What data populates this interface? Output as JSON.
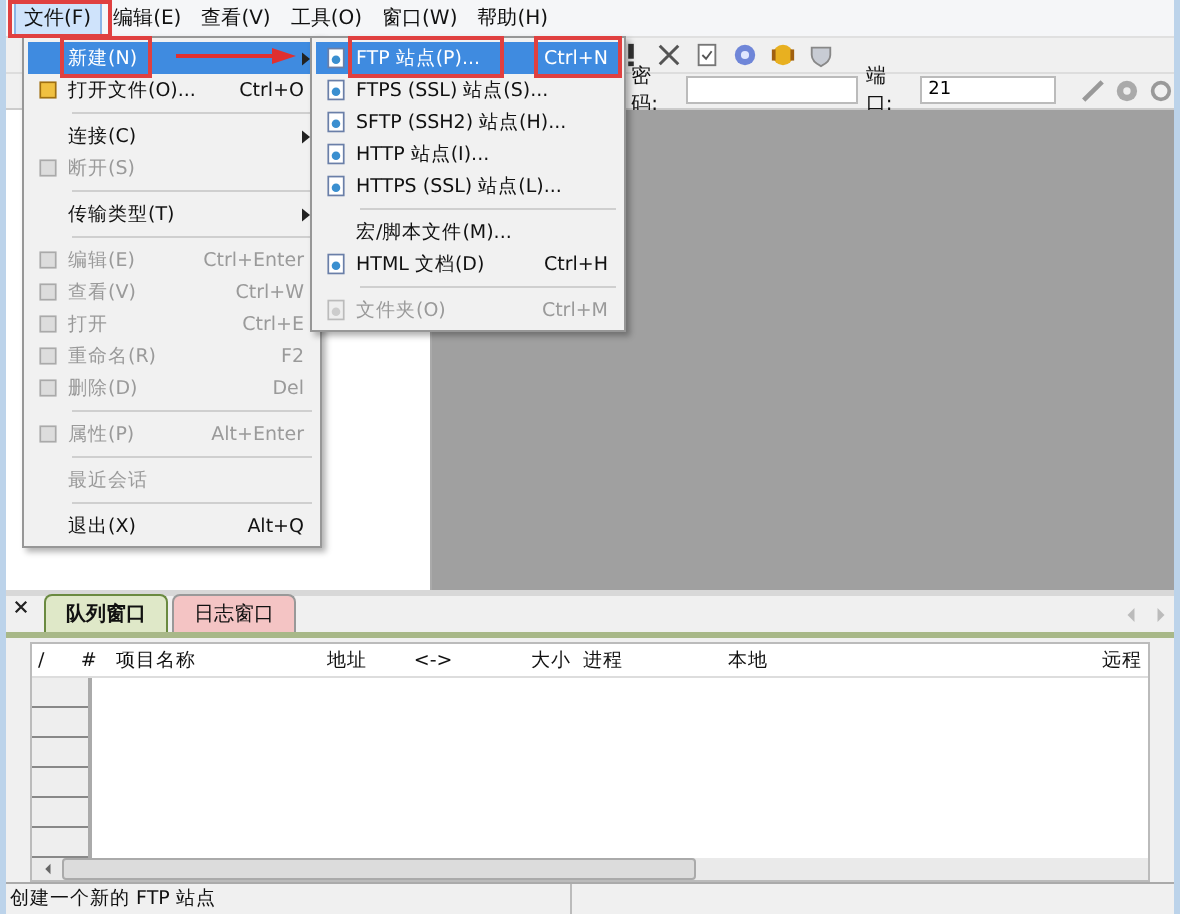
{
  "menubar": [
    {
      "label": "文件(F)",
      "selected": true
    },
    {
      "label": "编辑(E)",
      "selected": false
    },
    {
      "label": "查看(V)",
      "selected": false
    },
    {
      "label": "工具(O)",
      "selected": false
    },
    {
      "label": "窗口(W)",
      "selected": false
    },
    {
      "label": "帮助(H)",
      "selected": false
    }
  ],
  "toolbar": {
    "password_label": "密码:",
    "port_label": "端口:",
    "port_value": "21"
  },
  "file_menu": [
    {
      "kind": "item",
      "label": "新建(N)",
      "disabled": false,
      "selected": true,
      "submenu": true
    },
    {
      "kind": "item",
      "label": "打开文件(O)...",
      "shortcut": "Ctrl+O",
      "icon": true,
      "disabled": false,
      "selected": false
    },
    {
      "kind": "separator"
    },
    {
      "kind": "item",
      "label": "连接(C)",
      "disabled": false,
      "selected": false,
      "submenu": true
    },
    {
      "kind": "item",
      "label": "断开(S)",
      "icon": true,
      "disabled": true,
      "selected": false
    },
    {
      "kind": "separator"
    },
    {
      "kind": "item",
      "label": "传输类型(T)",
      "disabled": false,
      "selected": false,
      "submenu": true
    },
    {
      "kind": "separator"
    },
    {
      "kind": "item",
      "label": "编辑(E)",
      "shortcut": "Ctrl+Enter",
      "icon": true,
      "disabled": true,
      "selected": false
    },
    {
      "kind": "item",
      "label": "查看(V)",
      "shortcut": "Ctrl+W",
      "icon": true,
      "disabled": true,
      "selected": false
    },
    {
      "kind": "item",
      "label": "打开",
      "shortcut": "Ctrl+E",
      "icon": true,
      "disabled": true,
      "selected": false
    },
    {
      "kind": "item",
      "label": "重命名(R)",
      "shortcut": "F2",
      "icon": true,
      "disabled": true,
      "selected": false
    },
    {
      "kind": "item",
      "label": "删除(D)",
      "shortcut": "Del",
      "icon": true,
      "disabled": true,
      "selected": false
    },
    {
      "kind": "separator"
    },
    {
      "kind": "item",
      "label": "属性(P)",
      "shortcut": "Alt+Enter",
      "icon": true,
      "disabled": true,
      "selected": false
    },
    {
      "kind": "separator"
    },
    {
      "kind": "item",
      "label": "最近会话",
      "disabled": true,
      "selected": false
    },
    {
      "kind": "separator"
    },
    {
      "kind": "item",
      "label": "退出(X)",
      "shortcut": "Alt+Q",
      "disabled": false,
      "selected": false
    }
  ],
  "new_submenu": [
    {
      "kind": "item",
      "label": "FTP 站点(P)...",
      "shortcut": "Ctrl+N",
      "icon": true,
      "disabled": false,
      "selected": true
    },
    {
      "kind": "item",
      "label": "FTPS (SSL) 站点(S)...",
      "icon": true,
      "disabled": false,
      "selected": false
    },
    {
      "kind": "item",
      "label": "SFTP (SSH2) 站点(H)...",
      "icon": true,
      "disabled": false,
      "selected": false
    },
    {
      "kind": "item",
      "label": "HTTP 站点(I)...",
      "icon": true,
      "disabled": false,
      "selected": false
    },
    {
      "kind": "item",
      "label": "HTTPS (SSL) 站点(L)...",
      "icon": true,
      "disabled": false,
      "selected": false
    },
    {
      "kind": "separator"
    },
    {
      "kind": "item",
      "label": "宏/脚本文件(M)...",
      "disabled": false,
      "selected": false
    },
    {
      "kind": "item",
      "label": "HTML 文档(D)",
      "shortcut": "Ctrl+H",
      "icon": true,
      "disabled": false,
      "selected": false
    },
    {
      "kind": "separator"
    },
    {
      "kind": "item",
      "label": "文件夹(O)",
      "shortcut": "Ctrl+M",
      "icon": true,
      "disabled": true,
      "selected": false
    }
  ],
  "queue_tabs": [
    {
      "label": "队列窗口",
      "selected": true,
      "color": "#dfe8c8"
    },
    {
      "label": "日志窗口",
      "selected": false,
      "color": "#f4c4c4"
    }
  ],
  "table": {
    "columns": [
      "/",
      "#",
      "项目名称",
      "地址",
      "<->",
      "大小",
      "进程",
      "本地",
      "远程"
    ]
  },
  "status_bar": "创建一个新的 FTP 站点"
}
